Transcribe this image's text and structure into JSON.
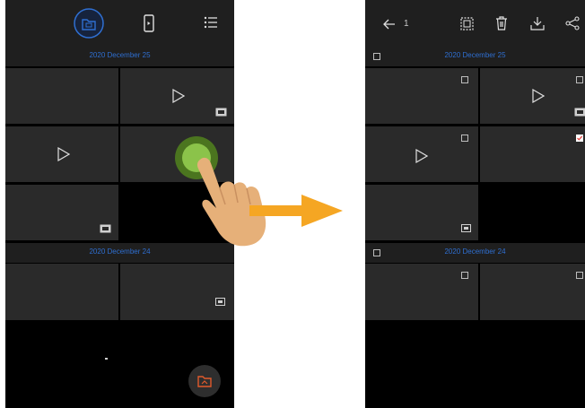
{
  "left_screen": {
    "toolbar_icons": [
      "folder-icon",
      "phone-icon",
      "list-icon"
    ],
    "sections": [
      {
        "date": "2020 December 25"
      },
      {
        "date": "2020 December 24"
      }
    ]
  },
  "right_screen": {
    "selected_count": "1",
    "toolbar_icons": [
      "back-arrow-icon",
      "select-all-icon",
      "trash-icon",
      "download-icon",
      "share-icon"
    ],
    "sections": [
      {
        "date": "2020 December 25"
      },
      {
        "date": "2020 December 24"
      }
    ]
  },
  "colors": {
    "accent_blue": "#2f6fd1",
    "arrow_orange": "#f5a623",
    "highlight_green": "#8bc34a"
  }
}
